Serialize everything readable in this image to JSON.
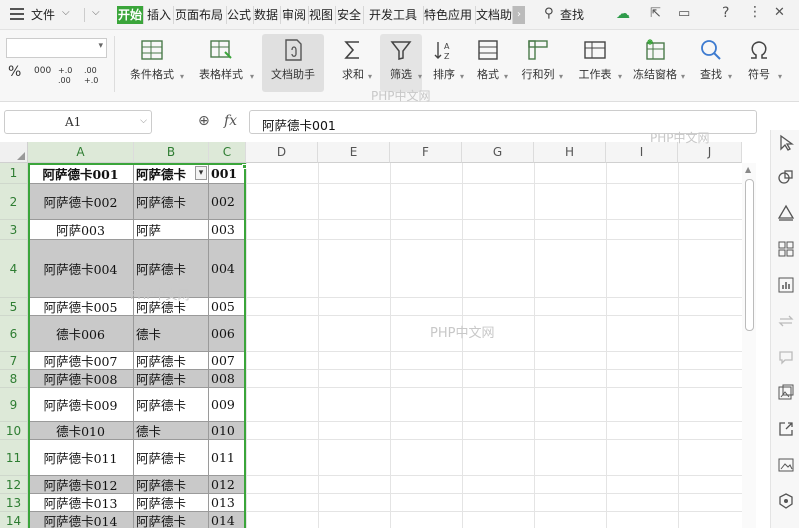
{
  "menubar": {
    "file_label": "文件",
    "tabs": [
      "开始",
      "插入",
      "页面布局",
      "公式",
      "数据",
      "审阅",
      "视图",
      "安全",
      "开发工具",
      "特色应用",
      "文档助"
    ],
    "active_tab": "开始",
    "search_label": "查找"
  },
  "ribbon": {
    "format_buttons": [
      "%",
      "000",
      "+.0 .00",
      ".00 +.0"
    ],
    "buttons": [
      {
        "label": "条件格式",
        "icon": "conditional-format-icon"
      },
      {
        "label": "表格样式",
        "icon": "table-style-icon"
      },
      {
        "label": "文档助手",
        "icon": "doc-assistant-icon"
      },
      {
        "label": "求和",
        "icon": "sigma-icon"
      },
      {
        "label": "筛选",
        "icon": "filter-icon"
      },
      {
        "label": "排序",
        "icon": "sort-icon"
      },
      {
        "label": "格式",
        "icon": "format-icon"
      },
      {
        "label": "行和列",
        "icon": "rows-cols-icon"
      },
      {
        "label": "工作表",
        "icon": "worksheet-icon"
      },
      {
        "label": "冻结窗格",
        "icon": "freeze-icon"
      },
      {
        "label": "查找",
        "icon": "search-icon"
      },
      {
        "label": "符号",
        "icon": "omega-icon"
      }
    ]
  },
  "formula_bar": {
    "cell_ref": "A1",
    "fx": "fx",
    "value": "阿萨德卡001"
  },
  "sheet": {
    "columns": [
      "A",
      "B",
      "C",
      "D",
      "E",
      "F",
      "G",
      "H",
      "I",
      "J"
    ],
    "rows": [
      {
        "num": "1",
        "a": "阿萨德卡001",
        "b": "阿萨德卡",
        "c": "001"
      },
      {
        "num": "2",
        "a": "阿萨德卡002",
        "b": "阿萨德卡",
        "c": "002"
      },
      {
        "num": "3",
        "a": "阿萨003",
        "b": "阿萨",
        "c": "003"
      },
      {
        "num": "4",
        "a": "阿萨德卡004",
        "b": "阿萨德卡",
        "c": "004"
      },
      {
        "num": "5",
        "a": "阿萨德卡005",
        "b": "阿萨德卡",
        "c": "005"
      },
      {
        "num": "6",
        "a": "德卡006",
        "b": "德卡",
        "c": "006"
      },
      {
        "num": "7",
        "a": "阿萨德卡007",
        "b": "阿萨德卡",
        "c": "007"
      },
      {
        "num": "8",
        "a": "阿萨德卡008",
        "b": "阿萨德卡",
        "c": "008"
      },
      {
        "num": "9",
        "a": "阿萨德卡009",
        "b": "阿萨德卡",
        "c": "009"
      },
      {
        "num": "10",
        "a": "德卡010",
        "b": "德卡",
        "c": "010"
      },
      {
        "num": "11",
        "a": "阿萨德卡011",
        "b": "阿萨德卡",
        "c": "011"
      },
      {
        "num": "12",
        "a": "阿萨德卡012",
        "b": "阿萨德卡",
        "c": "012"
      },
      {
        "num": "13",
        "a": "阿萨德卡013",
        "b": "阿萨德卡",
        "c": "013"
      },
      {
        "num": "14",
        "a": "阿萨德卡014",
        "b": "阿萨德卡",
        "c": "014"
      }
    ]
  },
  "watermark": "PHP中文网",
  "colors": {
    "accent": "#3aa53a",
    "selection_border": "#3aa53a",
    "shade": "#c9c9c9"
  }
}
